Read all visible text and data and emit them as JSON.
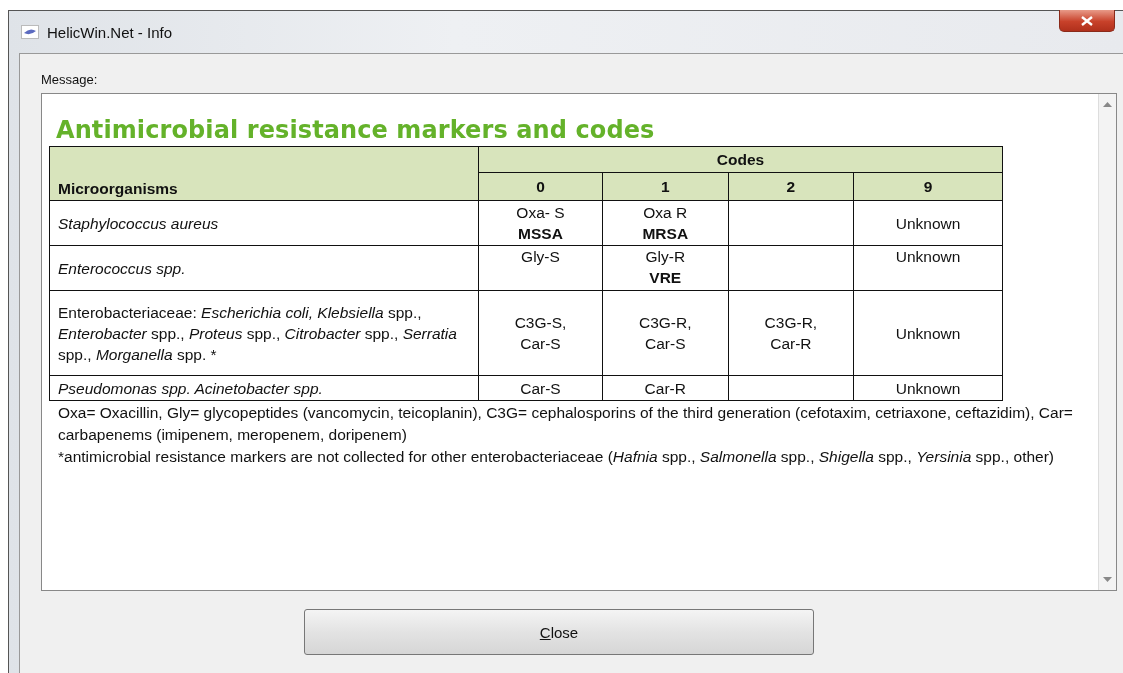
{
  "window": {
    "title": "HelicWin.Net - Info"
  },
  "message_label": "Message:",
  "document": {
    "heading": "Antimicrobial resistance markers and codes",
    "table": {
      "row_header": "Microorganisms",
      "group_header": "Codes",
      "columns": [
        "0",
        "1",
        "2",
        "9"
      ],
      "rows": [
        {
          "organism": "*Staphylococcus  aureus*",
          "cells": [
            [
              "Oxa- S",
              "**MSSA**"
            ],
            [
              "Oxa R",
              "**MRSA**"
            ],
            [],
            [
              "Unknown"
            ]
          ]
        },
        {
          "organism": "*Enterococcus spp.*",
          "cells": [
            [
              "Gly-S"
            ],
            [
              "Gly-R",
              "**VRE**"
            ],
            [],
            [
              "Unknown"
            ]
          ]
        },
        {
          "organism": "Enterobacteriaceae: *Escherichia coli, Klebsiella* spp., *Enterobacter* spp., *Proteus* spp., *Citrobacter* spp., *Serratia* spp.,  *Morganella* spp. *",
          "cells": [
            [
              "C3G-S,",
              "Car-S"
            ],
            [
              "C3G-R,",
              "Car-S"
            ],
            [
              "C3G-R,",
              "Car-R"
            ],
            [
              "Unknown"
            ]
          ]
        },
        {
          "organism": "*Pseudomonas spp. Acinetobacter spp.*",
          "cells": [
            [
              "Car-S"
            ],
            [
              "Car-R"
            ],
            [],
            [
              "Unknown"
            ]
          ]
        }
      ]
    },
    "notes": [
      "Oxa= Oxacillin, Gly= glycopeptides (vancomycin, teicoplanin), C3G= cephalosporins of the third generation (cefotaxim, cetriaxone, ceftazidim), Car= carbapenems (imipenem, meropenem, doripenem)",
      "*antimicrobial resistance markers are not collected for other enterobacteriaceae (*Hafnia* spp., *Salmonella* spp., *Shigella* spp., *Yersinia* spp., other)"
    ]
  },
  "buttons": [
    {
      "label": "Close"
    }
  ]
}
